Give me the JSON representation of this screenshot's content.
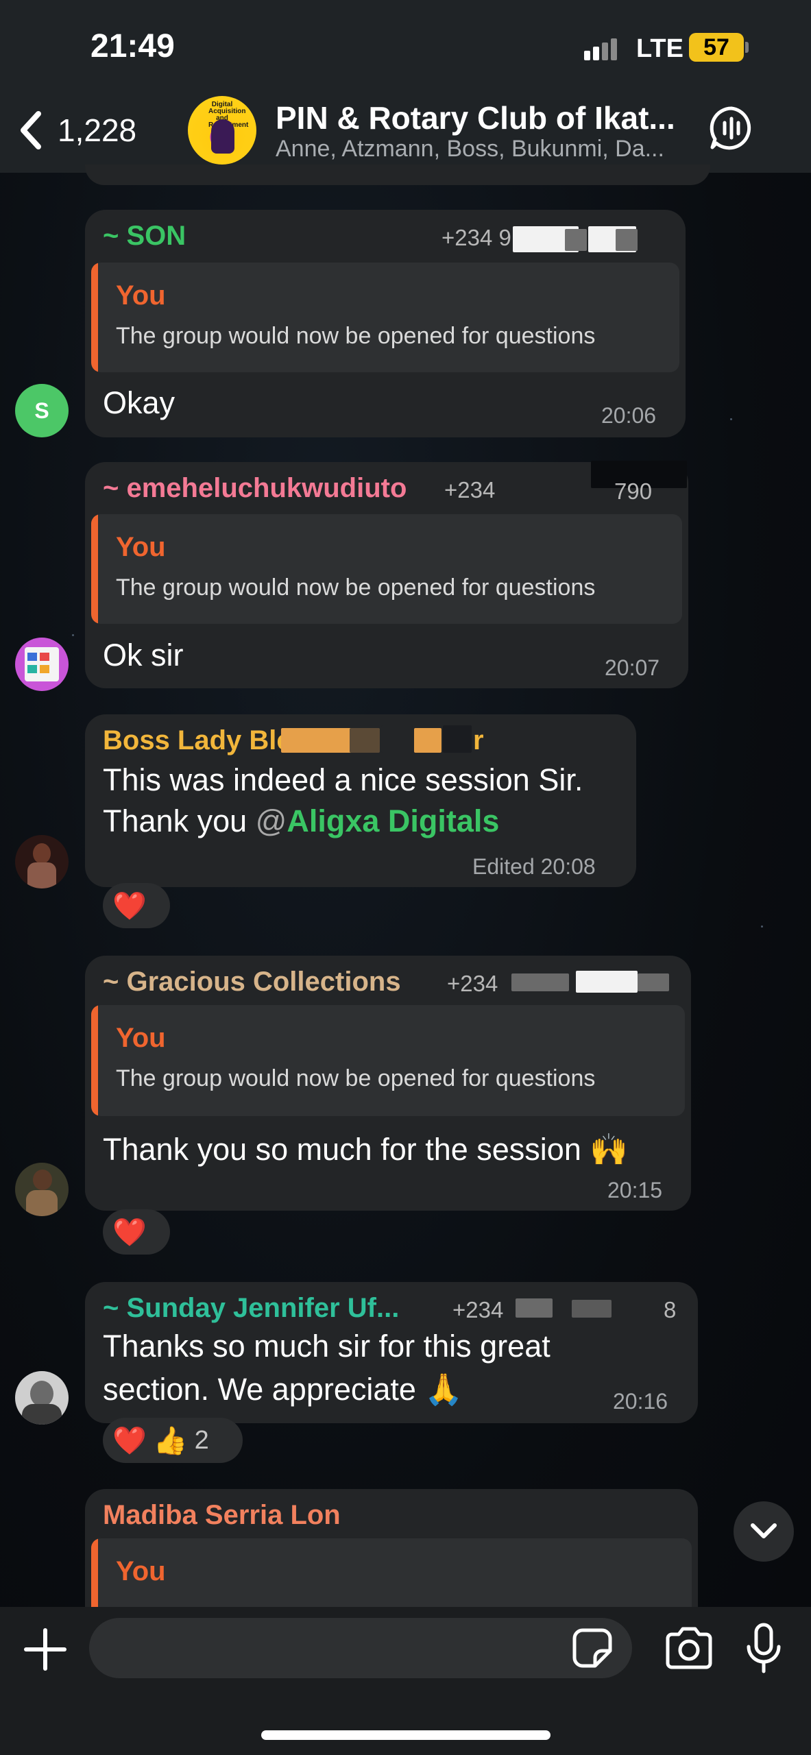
{
  "status_bar": {
    "time": "21:49",
    "network": "LTE",
    "battery": "57"
  },
  "header": {
    "back_count": "1,228",
    "title": "PIN & Rotary Club of Ikat...",
    "subtitle": "Anne, Atzmann, Boss, Bukunmi, Da...",
    "avatar_text": "Digital Acquisition and Recruitment"
  },
  "messages": [
    {
      "sender": "~ SON",
      "sender_color": "#3ac564",
      "phone": "+234 9",
      "avatar_letter": "S",
      "quote_author": "You",
      "quote_text": "The group would now be opened for questions",
      "text": "Okay",
      "time": "20:06"
    },
    {
      "sender": "~ emeheluchukwudiuto",
      "sender_color": "#f47a95",
      "phone": "+234",
      "phone_tail": "790",
      "quote_author": "You",
      "quote_text": "The group would now be opened for questions",
      "text": "Ok sir",
      "time": "20:07"
    },
    {
      "sender": "Boss Lady Ble",
      "sender_tail": "r",
      "sender_color": "#f2b63b",
      "text_line1": "This was indeed a nice session Sir.",
      "text_line2_prefix": "Thank you ",
      "mention_at": "@",
      "mention": "Aligxa Digitals",
      "time": "Edited 20:08",
      "reactions": [
        "❤️"
      ]
    },
    {
      "sender": "~ Gracious Collections",
      "sender_color": "#d7b48a",
      "phone": "+234",
      "quote_author": "You",
      "quote_text": "The group would now be opened for questions",
      "text": "Thank you so much for the session 🙌",
      "time": "20:15",
      "reactions": [
        "❤️"
      ]
    },
    {
      "sender": "~ Sunday Jennifer Uf...",
      "sender_color": "#2fc09a",
      "phone": "+234",
      "phone_tail": "8",
      "text_line1": "Thanks so much sir for this great",
      "text_line2": "section. We appreciate 🙏",
      "time": "20:16",
      "reactions": [
        "❤️",
        "👍"
      ],
      "reaction_count": "2"
    },
    {
      "sender": "Madiba Serria Lon",
      "sender_color": "#f2815e",
      "quote_author": "You"
    }
  ],
  "input": {
    "placeholder": ""
  },
  "icons": [
    "back-chevron-icon",
    "voice-chat-icon",
    "plus-icon",
    "sticker-icon",
    "camera-icon",
    "mic-icon",
    "chevron-down-icon"
  ]
}
